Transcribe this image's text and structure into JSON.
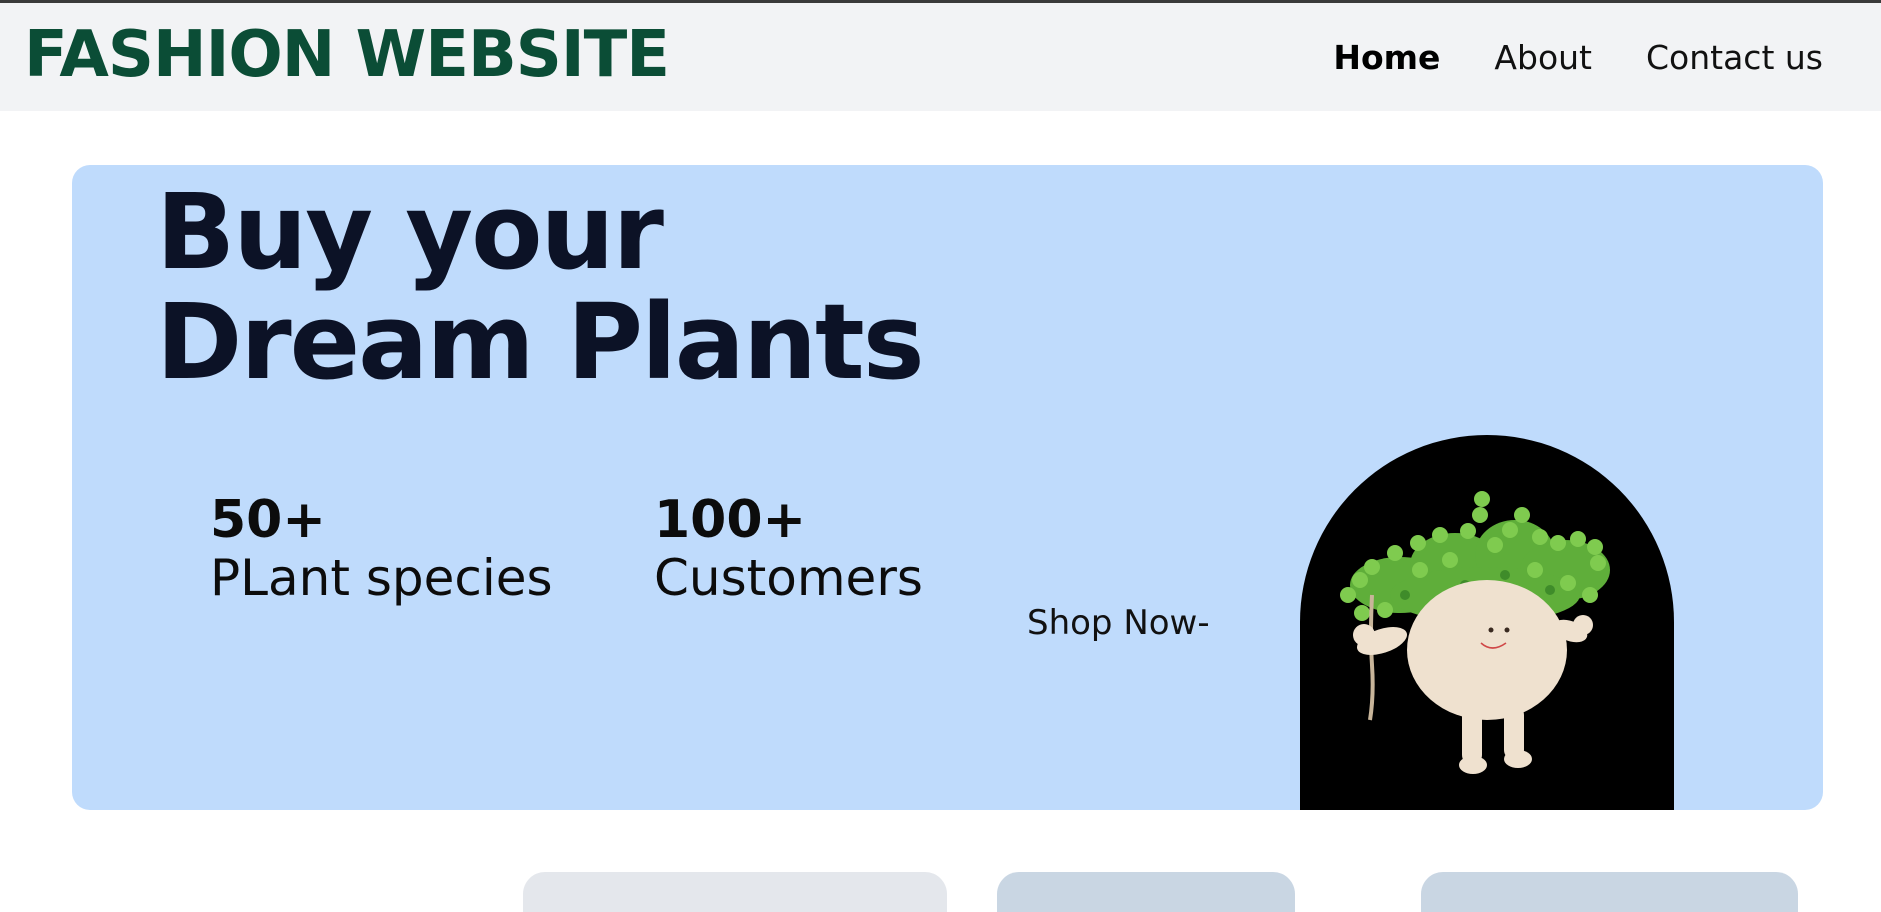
{
  "header": {
    "brand": "FASHION WEBSITE",
    "nav": [
      {
        "label": "Home",
        "active": true
      },
      {
        "label": "About",
        "active": false
      },
      {
        "label": "Contact us",
        "active": false
      }
    ]
  },
  "hero": {
    "title_line1": "Buy your",
    "title_line2": "Dream Plants",
    "stats": [
      {
        "value": "50+",
        "label": "PLant species"
      },
      {
        "value": "100+",
        "label": "Customers"
      }
    ],
    "cta": "Shop Now-",
    "image_icon": "plant-pot-illustration"
  },
  "colors": {
    "brand": "#0b4d36",
    "hero_bg": "#bfdbfc",
    "navbar_bg": "#f2f3f5",
    "arch_bg": "#000000"
  }
}
